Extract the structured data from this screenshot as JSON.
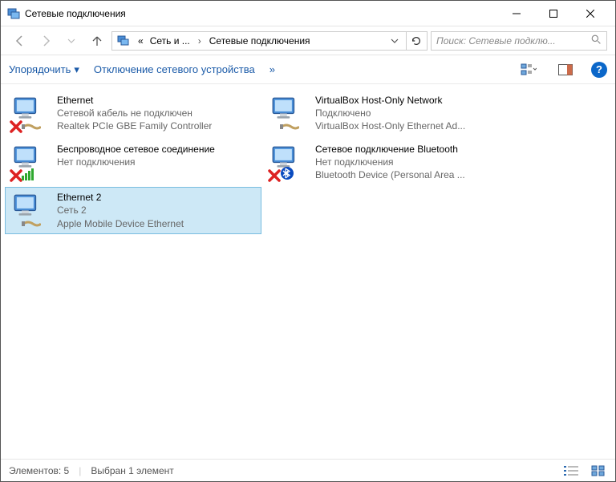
{
  "window": {
    "title": "Сетевые подключения"
  },
  "breadcrumb": {
    "prefix": "«",
    "part1": "Сеть и ...",
    "part2": "Сетевые подключения"
  },
  "search": {
    "placeholder": "Поиск: Сетевые подклю..."
  },
  "toolbar": {
    "organize": "Упорядочить",
    "disable": "Отключение сетевого устройства",
    "more": "»"
  },
  "connections": [
    {
      "name": "Ethernet",
      "status": "Сетевой кабель не подключен",
      "adapter": "Realtek PCIe GBE Family Controller",
      "disconnected": true,
      "sub_icon": "cable",
      "selected": false
    },
    {
      "name": "VirtualBox Host-Only Network",
      "status": "Подключено",
      "adapter": "VirtualBox Host-Only Ethernet Ad...",
      "disconnected": false,
      "sub_icon": "cable",
      "selected": false
    },
    {
      "name": "Беспроводное сетевое соединение",
      "status": "Нет подключения",
      "adapter": "",
      "disconnected": true,
      "sub_icon": "wifi",
      "selected": false
    },
    {
      "name": "Сетевое подключение Bluetooth",
      "status": "Нет подключения",
      "adapter": "Bluetooth Device (Personal Area ...",
      "disconnected": true,
      "sub_icon": "bluetooth",
      "selected": false
    },
    {
      "name": "Ethernet 2",
      "status": "Сеть 2",
      "adapter": "Apple Mobile Device Ethernet",
      "disconnected": false,
      "sub_icon": "cable",
      "selected": true
    }
  ],
  "statusbar": {
    "elements": "Элементов: 5",
    "selected": "Выбран 1 элемент"
  }
}
